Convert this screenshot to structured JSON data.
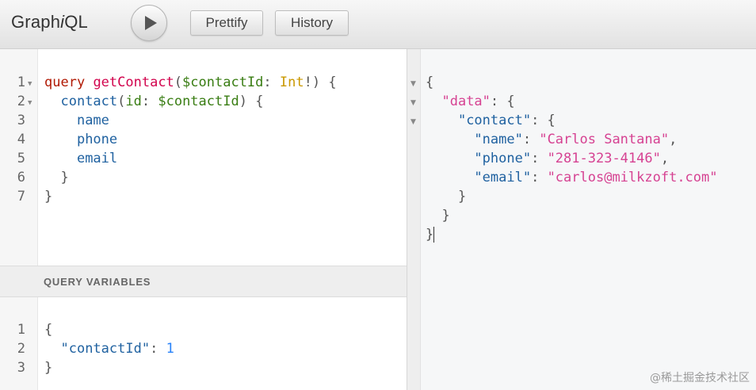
{
  "app": {
    "title_regular": "Graph",
    "title_italic": "i",
    "title_suffix": "QL"
  },
  "toolbar": {
    "prettify_label": "Prettify",
    "history_label": "History"
  },
  "query_editor": {
    "line_numbers": [
      "1",
      "2",
      "3",
      "4",
      "5",
      "6",
      "7"
    ],
    "l1": {
      "kw": "query",
      "name": "getContact",
      "open": "(",
      "var": "$contactId",
      "colon": ": ",
      "type": "Int",
      "bang": "!",
      "close": ") {"
    },
    "l2": {
      "field": "contact",
      "open": "(",
      "arg": "id",
      "colon": ": ",
      "var": "$contactId",
      "close": ") {"
    },
    "l3": "name",
    "l4": "phone",
    "l5": "email",
    "l6": "}",
    "l7": "}"
  },
  "variables_panel": {
    "title": "QUERY VARIABLES",
    "line_numbers": [
      "1",
      "2",
      "3"
    ],
    "l1": "{",
    "l2_key": "\"contactId\"",
    "l2_colon": ": ",
    "l2_value": "1",
    "l3": "}"
  },
  "result": {
    "l1": "{",
    "l2_key": "\"data\"",
    "l2_rest": ": {",
    "l3_key": "\"contact\"",
    "l3_rest": ": {",
    "l4_key": "\"name\"",
    "l4_colon": ": ",
    "l4_value": "\"Carlos Santana\"",
    "l4_comma": ",",
    "l5_key": "\"phone\"",
    "l5_colon": ": ",
    "l5_value": "\"281-323-4146\"",
    "l5_comma": ",",
    "l6_key": "\"email\"",
    "l6_colon": ": ",
    "l6_value": "\"carlos@milkzoft.com\"",
    "l7": "}",
    "l8": "}",
    "l9": "}"
  },
  "watermark": "@稀土掘金技术社区",
  "icons": {
    "run": "play-icon",
    "fold": "fold-arrow-icon"
  }
}
